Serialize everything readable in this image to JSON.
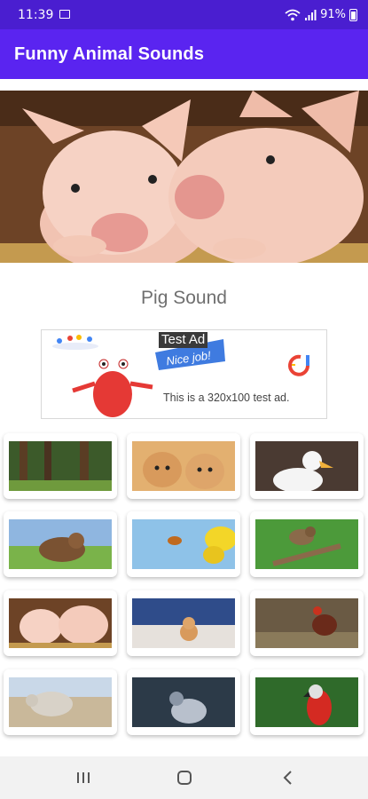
{
  "status_bar": {
    "time": "11:39",
    "battery": "91%"
  },
  "app_bar": {
    "title": "Funny Animal Sounds"
  },
  "current_sound": {
    "title": "Pig Sound"
  },
  "ad": {
    "tag": "Test Ad",
    "banner_text": "Nice job!",
    "description": "This is a 320x100 test ad."
  },
  "animals": [
    "forest",
    "kittens",
    "duck",
    "cow",
    "bee",
    "sparrow",
    "pigs",
    "kitten",
    "rooster",
    "sheep",
    "pigeon",
    "parrot"
  ],
  "colors": {
    "status_bar": "#4a1ed0",
    "app_bar": "#5a24f0",
    "nav_bar": "#f2f2f2"
  }
}
